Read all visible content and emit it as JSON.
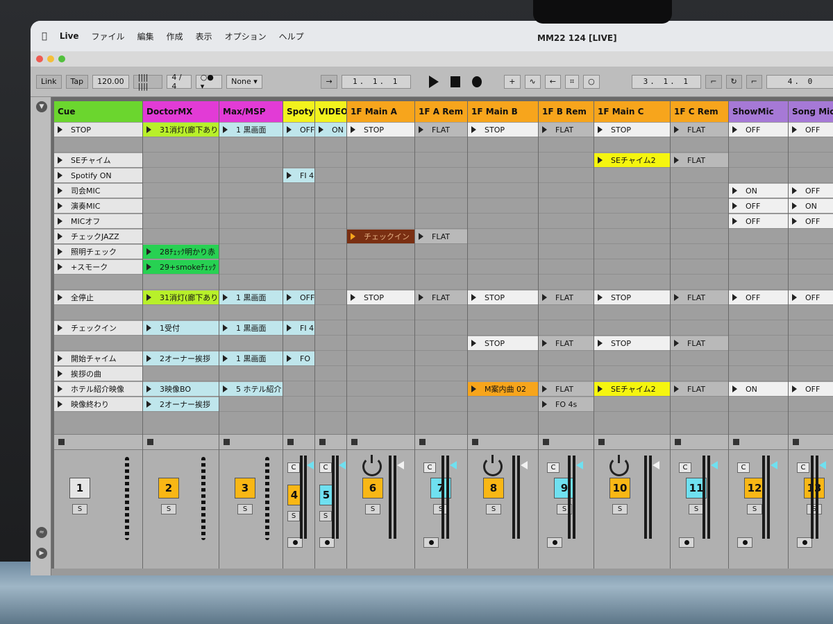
{
  "menubar": {
    "app": "Live",
    "items": [
      "ファイル",
      "編集",
      "作成",
      "表示",
      "オプション",
      "ヘルプ"
    ],
    "window_title": "MM22 124  [LIVE]"
  },
  "transport": {
    "link": "Link",
    "tap": "Tap",
    "tempo": "120.00",
    "signature": "4 / 4",
    "quantize": "None",
    "arrangement_position": "1.  1.  1",
    "loop_position": "3.  1.  1",
    "loop_length": "4.  0"
  },
  "colors": {
    "cue": "#6bd62e",
    "doctormx": "#e23bd6",
    "maxmsp": "#e23bd6",
    "spotify": "#f2f21d",
    "video": "#f2f21d",
    "orange": "#f7a51c",
    "purple": "#a679d6",
    "green_clip": "#27d152",
    "yellow_clip": "#f5f50f",
    "lightblue": "#bfe6ec",
    "cyan_num": "#6fe0f0",
    "orange_num": "#f9b715"
  },
  "tracks": [
    {
      "name": "Cue",
      "color": "#6bd62e",
      "width": 128
    },
    {
      "name": "DoctorMX",
      "color": "#e23bd6",
      "width": 110
    },
    {
      "name": "Max/MSP",
      "color": "#e23bd6",
      "width": 92
    },
    {
      "name": "Spoty",
      "color": "#f2f21d",
      "width": 46
    },
    {
      "name": "VIDEO",
      "color": "#f2f21d",
      "width": 46
    },
    {
      "name": "1F Main A",
      "color": "#f7a51c",
      "width": 98
    },
    {
      "name": "1F A Rem",
      "color": "#f7a51c",
      "width": 76
    },
    {
      "name": "1F Main B",
      "color": "#f7a51c",
      "width": 102
    },
    {
      "name": "1F B Rem",
      "color": "#f7a51c",
      "width": 80
    },
    {
      "name": "1F Main C",
      "color": "#f7a51c",
      "width": 110
    },
    {
      "name": "1F C Rem",
      "color": "#f7a51c",
      "width": 84
    },
    {
      "name": "ShowMic",
      "color": "#a679d6",
      "width": 86
    },
    {
      "name": "Song Mic",
      "color": "#a679d6",
      "width": 70
    }
  ],
  "cue_scenes": [
    "STOP",
    "",
    "SEチャイム",
    "Spotify ON",
    "司会MIC",
    "演奏MIC",
    "MICオフ",
    "チェックJAZZ",
    "照明チェック",
    "+スモーク",
    "",
    "全停止",
    "",
    "チェックイン",
    "",
    "開始チャイム",
    "挨拶の曲",
    "ホテル紹介映像",
    "映像終わり"
  ],
  "clips": {
    "doctormx": {
      "0": "31消灯(廊下あり",
      "8": "28ﾁｪｯｸ明かり赤",
      "9": "29+smokeﾁｪｯｸ",
      "11": "31消灯(廊下あり",
      "13": "1受付",
      "15": "2オーナー挨拶",
      "17": "3映像BO",
      "18": "2オーナー挨拶"
    },
    "maxmsp": {
      "0": "1 黒画面",
      "11": "1 黒画面",
      "13": "1 黒画面",
      "15": "1 黒画面",
      "17": "5 ホテル紹介"
    },
    "spotify": {
      "0": "OFF",
      "3": "FI 4",
      "11": "OFF",
      "13": "FI 4",
      "15": "FO"
    },
    "video": {
      "0": "ON"
    },
    "main_a": {
      "0": "STOP",
      "7": "チェックイン",
      "11": "STOP"
    },
    "a_rem": {
      "0": "FLAT",
      "7": "FLAT",
      "11": "FLAT"
    },
    "main_b": {
      "0": "STOP",
      "11": "STOP",
      "14": "STOP",
      "17": "M案内曲 02"
    },
    "b_rem": {
      "0": "FLAT",
      "11": "FLAT",
      "14": "FLAT",
      "17": "FLAT",
      "18": "FO 4s"
    },
    "main_c": {
      "0": "STOP",
      "2": "SEチャイム2",
      "11": "STOP",
      "14": "STOP",
      "17": "SEチャイム2"
    },
    "c_rem": {
      "0": "FLAT",
      "2": "FLAT",
      "11": "FLAT",
      "14": "FLAT",
      "17": "FLAT"
    },
    "showmic": {
      "0": "OFF",
      "4": "ON",
      "5": "OFF",
      "6": "OFF",
      "11": "OFF",
      "17": "ON"
    },
    "songmic": {
      "0": "OFF",
      "4": "OFF",
      "5": "ON",
      "6": "OFF",
      "11": "OFF",
      "17": "OFF"
    }
  },
  "mixer": {
    "numbers": [
      "1",
      "2",
      "3",
      "4",
      "5",
      "6",
      "7",
      "8",
      "9",
      "10",
      "11",
      "12",
      "13"
    ],
    "solo": "S",
    "cue_label": "C"
  }
}
